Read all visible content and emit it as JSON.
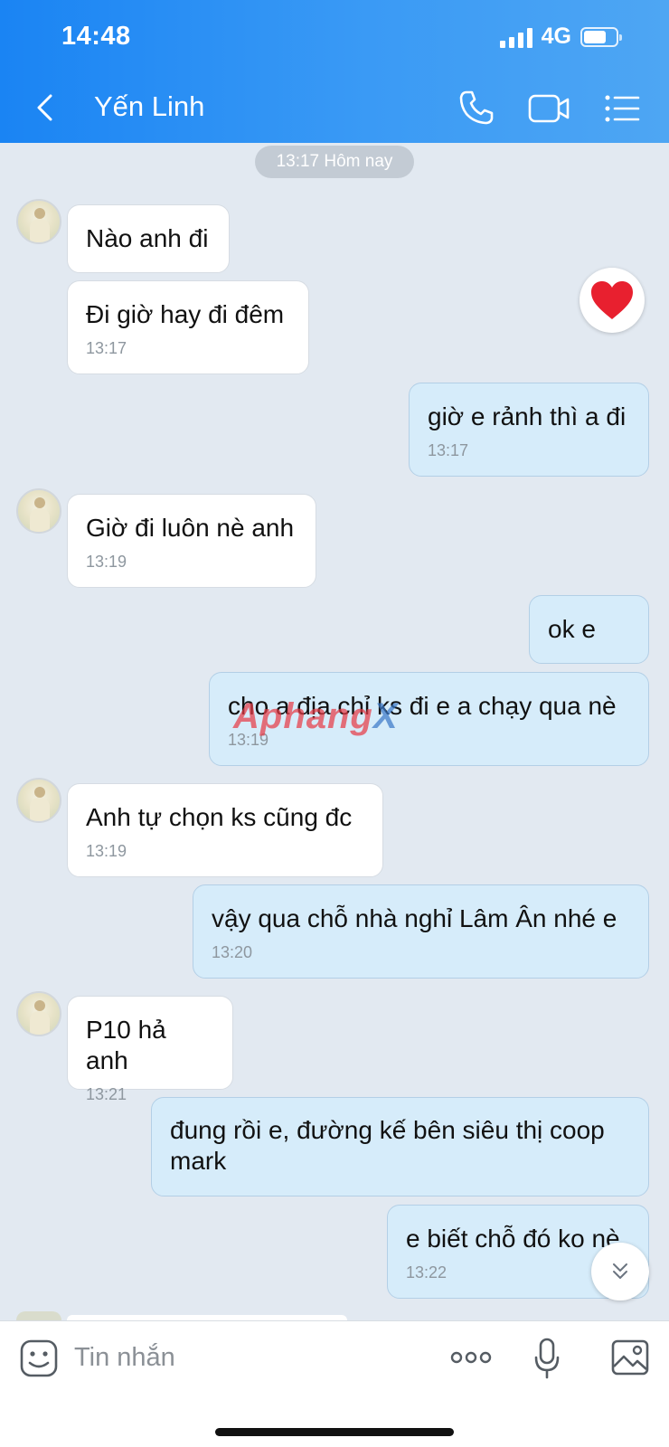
{
  "status_bar": {
    "time": "14:48",
    "network": "4G"
  },
  "header": {
    "contact_name": "Yến Linh",
    "icons": [
      "back-icon",
      "phone-icon",
      "video-call-icon",
      "menu-icon"
    ]
  },
  "date_chip": "13:17 Hôm nay",
  "messages": [
    {
      "dir": "in",
      "text": "Nào anh đi",
      "time": ""
    },
    {
      "dir": "in",
      "text": "Đi giờ hay đi đêm",
      "time": "13:17"
    },
    {
      "dir": "out",
      "text": "giờ e rảnh thì a đi",
      "time": "13:17"
    },
    {
      "dir": "in",
      "text": "Giờ đi luôn nè anh",
      "time": "13:19"
    },
    {
      "dir": "out",
      "text": "ok e",
      "time": ""
    },
    {
      "dir": "out",
      "text": "cho a địa chỉ ks đi e a chạy qua nè",
      "time": "13:19"
    },
    {
      "dir": "in",
      "text": "Anh tự chọn ks cũng đc",
      "time": "13:19"
    },
    {
      "dir": "out",
      "text": "vậy qua chỗ nhà nghỉ Lâm Ân nhé e",
      "time": "13:20"
    },
    {
      "dir": "in",
      "text": "P10 hả anh",
      "time": "13:21"
    },
    {
      "dir": "out",
      "text": "đung rồi e, đường kế bên siêu thị coop mark",
      "time": ""
    },
    {
      "dir": "out",
      "text": "e biết chỗ đó ko nè",
      "time": "13:22"
    }
  ],
  "reaction": {
    "icon": "heart-icon",
    "color": "#e8202f"
  },
  "watermark": {
    "main": "Aphang",
    "accent": "X"
  },
  "composer": {
    "placeholder": "Tin nhắn"
  },
  "colors": {
    "header_start": "#1a84f3",
    "header_end": "#4ea6f3",
    "chat_bg": "#e2e9f1",
    "out_bubble": "#d6ecfa",
    "in_bubble": "#ffffff"
  }
}
